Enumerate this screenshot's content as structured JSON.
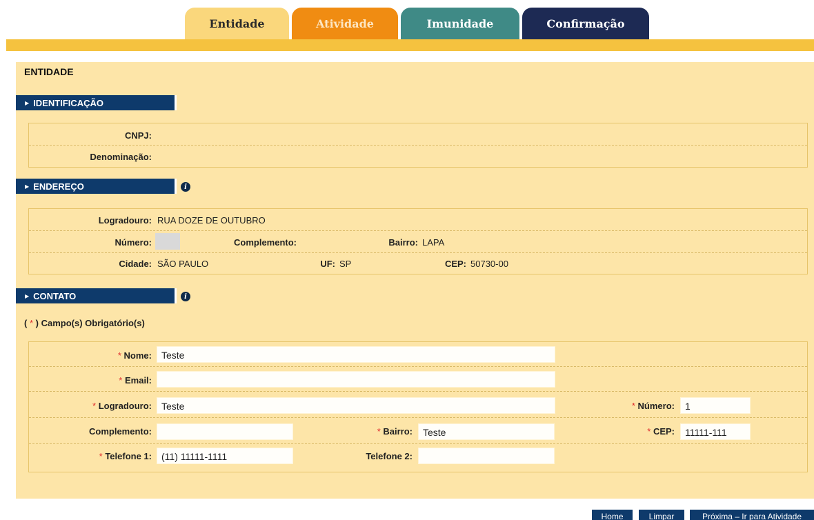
{
  "tabs": [
    {
      "label": "Entidade"
    },
    {
      "label": "Atividade"
    },
    {
      "label": "Imunidade"
    },
    {
      "label": "Confirmação"
    }
  ],
  "page_title": "ENTIDADE",
  "sections": {
    "identificacao": {
      "title": "IDENTIFICAÇÃO",
      "cnpj_label": "CNPJ:",
      "cnpj_value": "",
      "denominacao_label": "Denominação:",
      "denominacao_value": ""
    },
    "endereco": {
      "title": "ENDEREÇO",
      "logradouro_label": "Logradouro:",
      "logradouro_value": "RUA DOZE DE OUTUBRO",
      "numero_label": "Número:",
      "complemento_label": "Complemento:",
      "bairro_label": "Bairro:",
      "bairro_value": "LAPA",
      "cidade_label": "Cidade:",
      "cidade_value": "SÃO PAULO",
      "uf_label": "UF:",
      "uf_value": "SP",
      "cep_label": "CEP:",
      "cep_value": "50730-00"
    },
    "contato": {
      "title": "CONTATO",
      "required_note_open": "(",
      "required_note_star": "*",
      "required_note_close": ") Campo(s) Obrigatório(s)",
      "nome_label": "Nome:",
      "nome_value": "Teste",
      "email_label": "Email:",
      "email_value": "",
      "logradouro_label": "Logradouro:",
      "logradouro_value": "Teste",
      "numero_label": "Número:",
      "numero_value": "1",
      "complemento_label": "Complemento:",
      "complemento_value": "",
      "bairro_label": "Bairro:",
      "bairro_value": "Teste",
      "cep_label": "CEP:",
      "cep_value": "11111-111",
      "telefone1_label": "Telefone 1:",
      "telefone1_value": "(11) 11111-1111",
      "telefone2_label": "Telefone 2:",
      "telefone2_value": ""
    }
  },
  "required_star": "*",
  "info_icon_glyph": "i",
  "arrow_glyph": "▶",
  "buttons": {
    "home": "Home",
    "limpar": "Limpar",
    "proxima": "Próxima – Ir para Atividade"
  },
  "colors": {
    "tab_entidade": "#fad77c",
    "tab_atividade": "#f08c12",
    "tab_imunidade": "#3f8a86",
    "tab_confirmacao": "#1d2a54",
    "section_header": "#0e3a6b",
    "panel": "#fde5a8",
    "required": "#e03030"
  }
}
